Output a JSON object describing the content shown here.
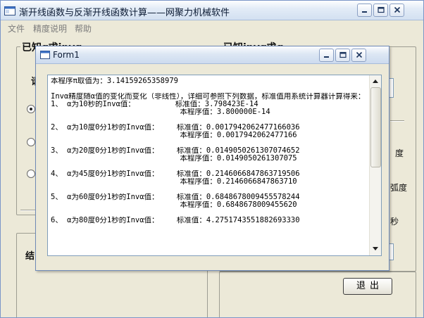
{
  "app": {
    "title": "渐开线函数与反渐开线函数计算——网聚力机械软件",
    "menu": [
      "文件",
      "精度说明",
      "帮助"
    ]
  },
  "main_form": {
    "group_left_title": "已知α求invα",
    "group_right_title": "已知invα求α",
    "left_fragment_label": "请",
    "result_label_left": "结",
    "right_fragments": [
      "度",
      "弧度",
      "秒"
    ],
    "radio_states": [
      true,
      false,
      false
    ],
    "exit_label": "退出"
  },
  "dialog": {
    "title": "Form1",
    "lines": [
      "本程序π取值为：3.14159265358979",
      "",
      "Invα精度随α值的变化而变化（非线性），详细可参照下列数据，标准值用系统计算器计算得来：",
      "1、 α为10秒的Invα值：         标准值：3.798423E-14",
      "                             本程序值：3.800000E-14",
      "",
      "2、 α为10度0分1秒的Invα值：    标准值：0.0017942062477166036",
      "                             本程序值：0.0017942062477166",
      "",
      "3、 α为20度0分1秒的Invα值：    标准值：0.0149050261307074652",
      "                             本程序值：0.014905026130707​5",
      "",
      "4、 α为45度0分1秒的Invα值：    标准值：0.2146066847863719506",
      "                             本程序值：0.214606684786371​0",
      "",
      "5、 α为60度0分1秒的Invα值：    标准值：0.6848678009455578244",
      "                             本程序值：0.6848678009455620",
      "",
      "6、 α为80度0分1秒的Invα值：    标准值：4.2751743551882693330"
    ]
  },
  "colors": {
    "window_bg": "#ece9d8",
    "title_gradient_top": "#fdfefe",
    "border_blue": "#7f9db9"
  },
  "icons": {
    "app": "app-window-icon",
    "minimize": "minimize-icon",
    "maximize": "maximize-icon",
    "close": "close-icon",
    "form1": "form-window-icon",
    "scroll_up": "scroll-up-arrow-icon",
    "scroll_down": "scroll-down-arrow-icon"
  }
}
